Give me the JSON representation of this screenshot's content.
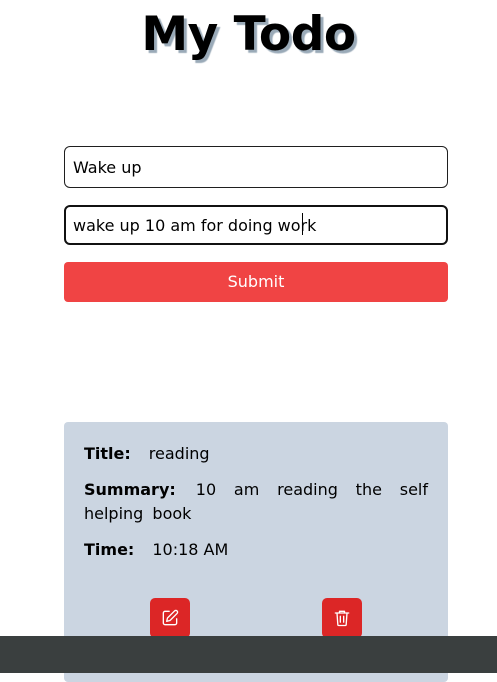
{
  "header": {
    "title": "My Todo"
  },
  "form": {
    "title_value": "Wake up",
    "summary_value": "wake up 10 am for doing work",
    "submit_label": "Submit"
  },
  "todos": [
    {
      "title_label": "Title:",
      "title": "reading",
      "summary_label": "Summary:",
      "summary": "10 am reading the self helping book",
      "time_label": "Time:",
      "time": "10:18 AM",
      "actions": {
        "edit_icon": "pencil-square-icon",
        "delete_icon": "trash-icon"
      }
    }
  ],
  "colors": {
    "submit": "#f04444",
    "card": "#cbd5e1",
    "action": "#dc2626",
    "bottom_bar": "#3a3f3f"
  }
}
